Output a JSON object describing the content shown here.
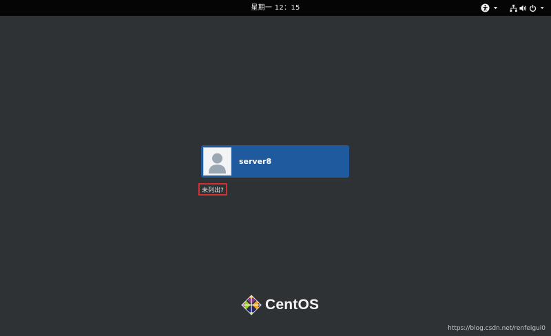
{
  "top_bar": {
    "clock": "星期一 12：15",
    "icons": [
      "accessibility-icon",
      "chevron-down-icon",
      "network-icon",
      "volume-icon",
      "power-icon"
    ]
  },
  "login": {
    "user_name": "server8",
    "not_listed_label": "未列出?"
  },
  "branding": {
    "logo_text": "CentOS"
  },
  "watermark": "https://blog.csdn.net/renfeigui0",
  "colors": {
    "background": "#2e3234",
    "top_bar": "#050505",
    "user_card": "#1f5a9e",
    "highlight_box": "#d43030"
  }
}
